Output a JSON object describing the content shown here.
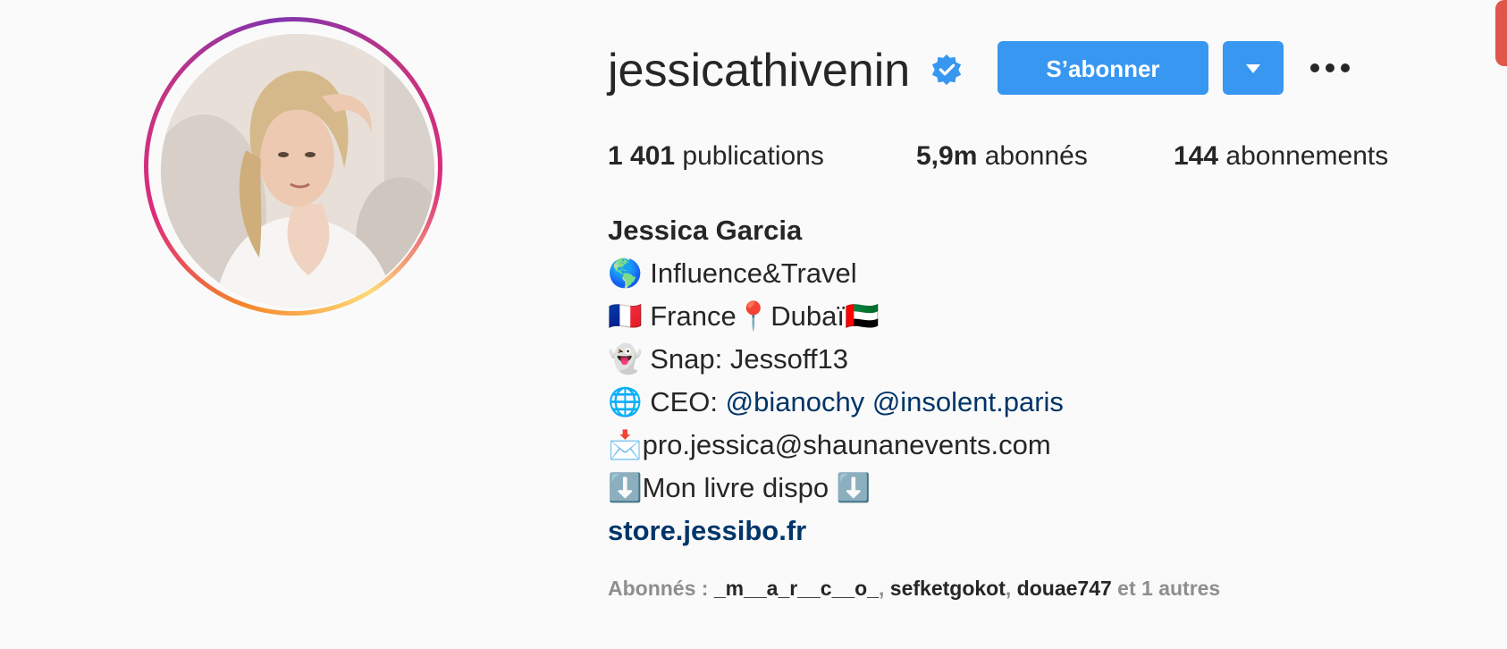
{
  "profile": {
    "username": "jessicathivenin",
    "verified_icon": "verified-badge-icon",
    "follow_label": "S’abonner",
    "dropdown_icon": "caret-down-icon",
    "more_icon": "more-options-icon"
  },
  "stats": {
    "posts_count": "1 401",
    "posts_label": "publications",
    "followers_count": "5,9m",
    "followers_label": "abonnés",
    "following_count": "144",
    "following_label": "abonnements"
  },
  "bio": {
    "name": "Jessica Garcia",
    "line1": "🌎 Influence&Travel",
    "line2": "🇫🇷 France📍Dubaï🇦🇪",
    "line3": "👻 Snap: Jessoff13",
    "line4_prefix": "🌐 CEO: ",
    "line4_link1": "@bianochy",
    "line4_link2": "@insolent.paris",
    "line5": "📩pro.jessica@shaunanevents.com",
    "line6": "⬇️Mon livre dispo ⬇️",
    "website": "store.jessibo.fr"
  },
  "followed_by": {
    "prefix": "Abonnés : ",
    "user1": "_m__a_r__c__o_",
    "sep1": ", ",
    "user2": "sefketgokot",
    "sep2": ", ",
    "user3": "douae747",
    "suffix": " et 1 autres"
  },
  "colors": {
    "accent": "#3897f0",
    "link": "#003569",
    "text": "#262626",
    "muted": "#8e8e8e",
    "background": "#fafafa"
  }
}
